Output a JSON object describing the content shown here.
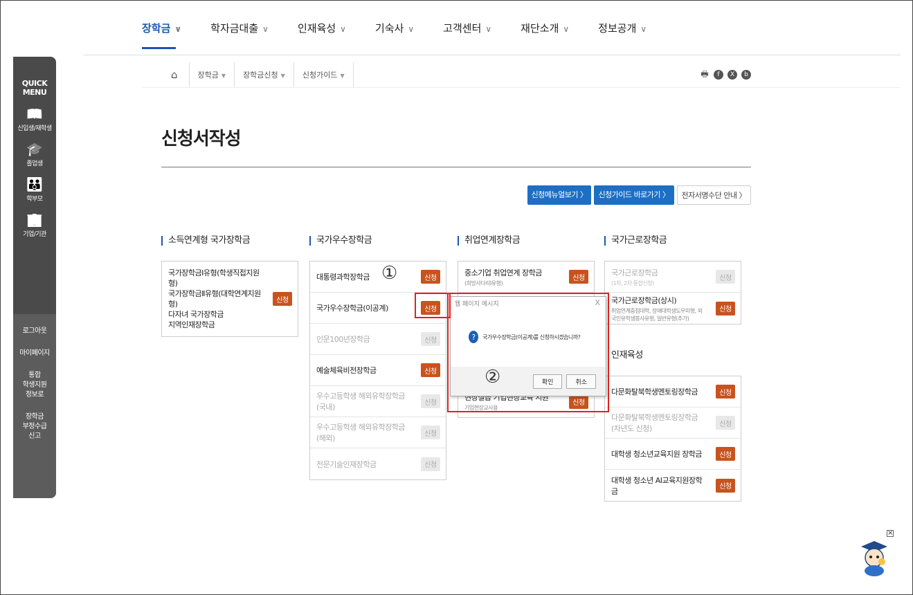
{
  "nav": {
    "items": [
      {
        "label": "장학금",
        "active": true
      },
      {
        "label": "학자금대출",
        "active": false
      },
      {
        "label": "인재육성",
        "active": false
      },
      {
        "label": "기숙사",
        "active": false
      },
      {
        "label": "고객센터",
        "active": false
      },
      {
        "label": "재단소개",
        "active": false
      },
      {
        "label": "정보공개",
        "active": false
      }
    ],
    "chevron": "∨"
  },
  "breadcrumb": {
    "home_icon": "home-icon",
    "items": [
      "장학금",
      "장학금신청",
      "신청가이드"
    ],
    "dropdown": "▼",
    "social": [
      "print-icon",
      "facebook-icon",
      "x-icon",
      "blog-icon"
    ]
  },
  "quick_menu": {
    "title_line1": "QUICK",
    "title_line2": "MENU",
    "items": [
      {
        "icon": "book-icon",
        "glyph": "📖",
        "label": "신입생/재학생"
      },
      {
        "icon": "graduate-cap-icon",
        "glyph": "🎓",
        "label": "졸업생"
      },
      {
        "icon": "parents-icon",
        "glyph": "👪",
        "label": "학부모"
      },
      {
        "icon": "building-icon",
        "glyph": "🏢",
        "label": "기업/기관"
      }
    ],
    "links": [
      "로그아웃",
      "마이페이지",
      "통합\n학생지원\n정보로",
      "장학금\n부정수급\n신고"
    ]
  },
  "page_title": "신청서작성",
  "buttons": {
    "manual": "신청메뉴얼보기 〉",
    "guide": "신청가이드 바로가기 〉",
    "esign": "전자서명수단 안내 〉"
  },
  "apply_label": "신청",
  "columns": [
    {
      "heading": "소득연계형 국가장학금",
      "tall": true,
      "rows": [
        {
          "lines": [
            "국가장학금Ⅰ유형(학생직접지원형)",
            "국가장학금Ⅱ유형(대학연계지원형)",
            "다자녀 국가장학금",
            "지역인재장학금"
          ],
          "active": true
        }
      ]
    },
    {
      "heading": "국가우수장학금",
      "rows": [
        {
          "title": "대통령과학장학금",
          "active": true
        },
        {
          "title": "국가우수장학금(이공계)",
          "active": true
        },
        {
          "title": "인문100년장학금",
          "active": false
        },
        {
          "title": "예술체육비전장학금",
          "active": true
        },
        {
          "title": "우수고등학생 해외유학장학금(국내)",
          "active": false
        },
        {
          "title": "우수고등학생 해외유학장학금(해외)",
          "active": false
        },
        {
          "title": "전문기술인재장학금",
          "active": false
        }
      ]
    },
    {
      "heading": "취업연계장학금",
      "rows": [
        {
          "title": "중소기업 취업연계 장학금",
          "sub": "(희망사다리Ⅰ유형)",
          "active": true
        },
        {
          "title": "",
          "active": true,
          "hidden": true
        },
        {
          "title": "",
          "active": true,
          "hidden": true
        },
        {
          "title": "",
          "active": true,
          "hidden": true
        },
        {
          "title": "현장실습 기업현장교육 지원",
          "sub": "기업현장교사용",
          "active": true
        }
      ]
    },
    {
      "heading": "국가근로장학금",
      "rows": [
        {
          "title": "국가근로장학금",
          "sub": "(1차, 2차 통합신청)",
          "active": false
        },
        {
          "title": "국가근로장학금(상시)",
          "sub": "취업연계중점대학, 장애대학생도우미형, 외국인유학생봉사유형, 일반유형(추가)",
          "active": true
        }
      ],
      "heading2": "인재육성",
      "rows2": [
        {
          "title": "다문화탈북학생멘토링장학금",
          "active": true
        },
        {
          "title": "다문화탈북학생멘토링장학금(차년도 신청)",
          "active": false
        },
        {
          "title": "대학생 청소년교육지원 장학금",
          "active": true
        },
        {
          "title": "대학생 청소년 AI교육지원장학금",
          "active": true
        }
      ]
    }
  ],
  "dialog": {
    "title": "웹 페이지 메시지",
    "close": "X",
    "message": "국가우수장학금(이공계)를 신청하시겠습니까?",
    "question_icon": "?",
    "ok": "확인",
    "cancel": "취소"
  },
  "markers": [
    "①",
    "②"
  ],
  "colors": {
    "brand_blue": "#1a56b0",
    "apply_orange": "#c8531e",
    "highlight_red": "#e0201e"
  }
}
